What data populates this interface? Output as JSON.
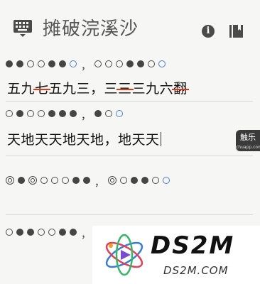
{
  "header": {
    "title": "摊破浣溪沙",
    "keyboard_icon": "keyboard-icon",
    "info_icon_glyph": "i",
    "bookmark_icon": "bookmark-icon"
  },
  "lines": [
    {
      "pattern": [
        "full",
        "full",
        "empty",
        "empty",
        "full",
        "full",
        "blue",
        "sep",
        "empty",
        "empty",
        "empty",
        "full",
        "full",
        "empty",
        "blue"
      ],
      "verse": [
        "五九",
        "七",
        "五九三，三",
        "三",
        "三九六",
        "翻"
      ],
      "struck": [
        false,
        true,
        false,
        true,
        false,
        true
      ]
    },
    {
      "pattern": [
        "empty",
        "full",
        "empty",
        "empty",
        "full",
        "full",
        "full",
        "sep",
        "full",
        "empty",
        "blue"
      ],
      "verse": [
        "天地天天地天地，地天天"
      ],
      "struck": [
        false
      ]
    },
    {
      "pattern": [
        "ring",
        "full",
        "ring",
        "empty",
        "empty",
        "empty",
        "full",
        "full",
        "sep",
        "ring",
        "empty",
        "full",
        "full",
        "empty",
        "blue"
      ],
      "verse": [],
      "struck": []
    },
    {
      "pattern": [
        "empty",
        "full",
        "full",
        "empty",
        "empty",
        "full",
        "full",
        "sep",
        "full",
        "empty",
        "blue"
      ],
      "verse": [],
      "struck": []
    }
  ],
  "badge": {
    "label": "触乐",
    "sublabel": "chuapp.com"
  },
  "watermark": {
    "brand": "DS2M",
    "domain": "DS2M.COM"
  },
  "colors": {
    "strike": "#d83a1a",
    "blue_circle": "#4a7fd6"
  }
}
